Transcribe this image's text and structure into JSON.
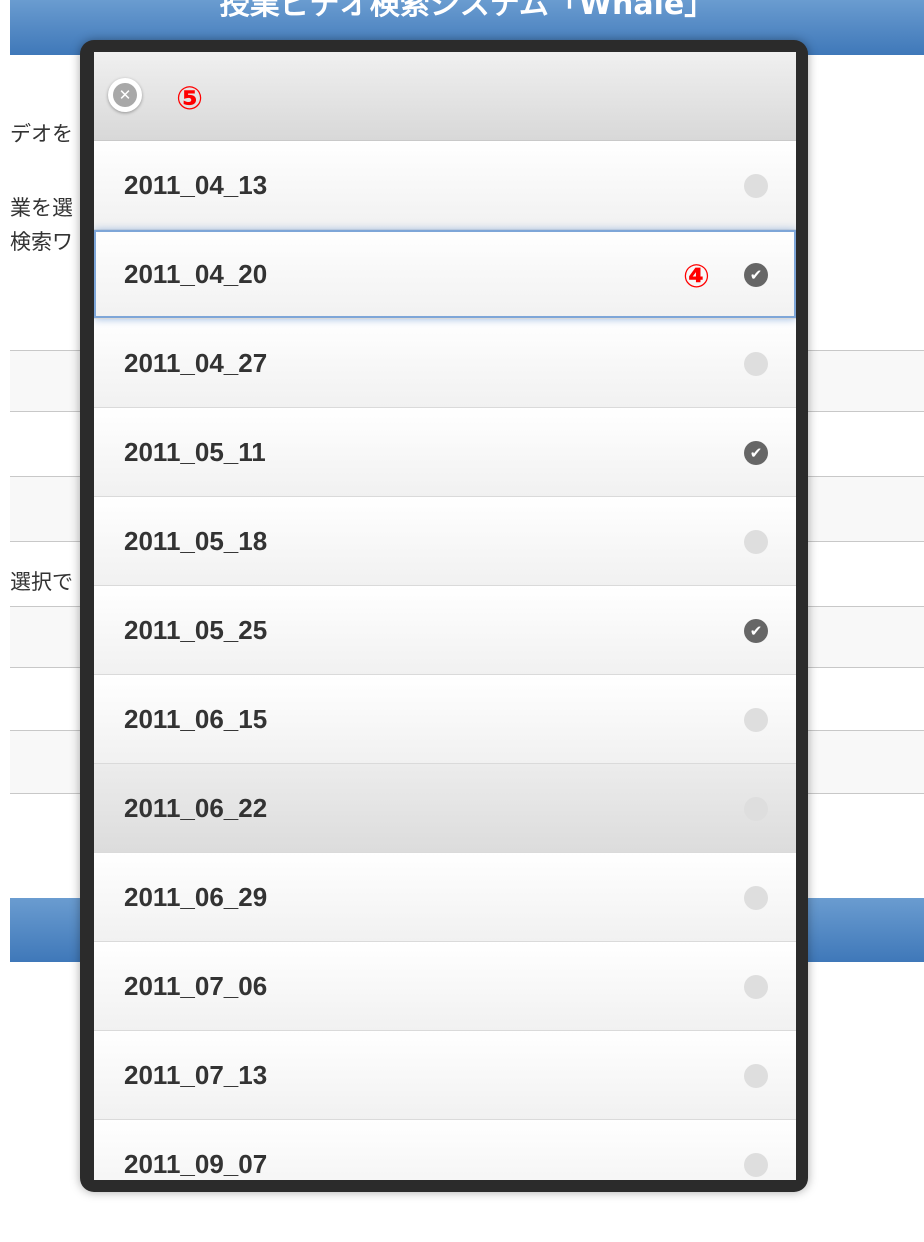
{
  "background": {
    "header_title": "授業ビデオ検索システム「Whale」",
    "partial_texts": [
      "デオを",
      "業を選",
      "検索ワ",
      "選択で"
    ]
  },
  "popup": {
    "close_label": "close",
    "close_annotation": "⑤",
    "selected_annotation": "④",
    "options": [
      {
        "label": "2011_04_13",
        "checked": false
      },
      {
        "label": "2011_04_20",
        "checked": true
      },
      {
        "label": "2011_04_27",
        "checked": false
      },
      {
        "label": "2011_05_11",
        "checked": true
      },
      {
        "label": "2011_05_18",
        "checked": false
      },
      {
        "label": "2011_05_25",
        "checked": true
      },
      {
        "label": "2011_06_15",
        "checked": false
      },
      {
        "label": "2011_06_22",
        "checked": false
      },
      {
        "label": "2011_06_29",
        "checked": false
      },
      {
        "label": "2011_07_06",
        "checked": false
      },
      {
        "label": "2011_07_13",
        "checked": false
      },
      {
        "label": "2011_09_07",
        "checked": false
      }
    ]
  },
  "colors": {
    "header_blue": "#4a82c0",
    "annotation_red": "#ff0000",
    "check_on": "#666666",
    "check_off": "#dedede"
  }
}
